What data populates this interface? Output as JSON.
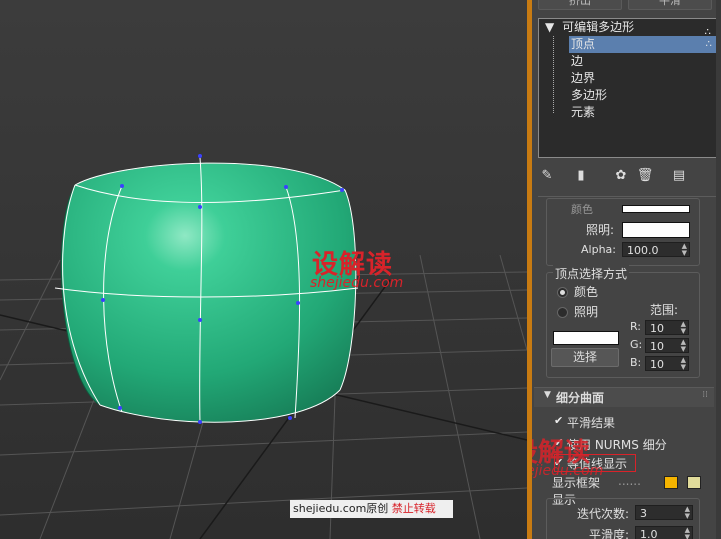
{
  "panel": {
    "top_buttons": [
      "挤出",
      "平滑"
    ],
    "modifier_stack": {
      "root": "可编辑多边形",
      "items": [
        "顶点",
        "边",
        "边界",
        "多边形",
        "元素"
      ],
      "selected": "顶点"
    },
    "vertex_color": {
      "color_label": "颜色",
      "illum_label": "照明:",
      "alpha_label": "Alpha:",
      "alpha_value": "100.0"
    },
    "vertex_select": {
      "title": "顶点选择方式",
      "radio_color": "颜色",
      "radio_illum": "照明",
      "range_label": "范围:",
      "r_label": "R:",
      "r_value": "10",
      "g_label": "G:",
      "g_value": "10",
      "b_label": "B:",
      "b_value": "10",
      "select_button": "选择"
    },
    "subdivision": {
      "title": "细分曲面",
      "smooth_result": "平滑结果",
      "use_nurms": "使用 NURMS 细分",
      "isoline": "等值线显示",
      "show_cage": "显示框架",
      "show_cage_dots": "......",
      "display_label": "显示",
      "iterations_label": "迭代次数:",
      "iterations_value": "3",
      "smoothness_label": "平滑度:",
      "smoothness_value": "1.0"
    },
    "colors": {
      "cage1": "#f5b400",
      "cage2": "#e0db9a"
    }
  },
  "watermark": {
    "brand": "设解读",
    "url": "shejiedu.com",
    "caption_site": "shejiedu.com",
    "caption_orig": "原创",
    "caption_forbid": "禁止转载"
  },
  "colors": {
    "object": "#2bb585",
    "divider": "#c87b12",
    "brand_red": "#d8232a"
  }
}
